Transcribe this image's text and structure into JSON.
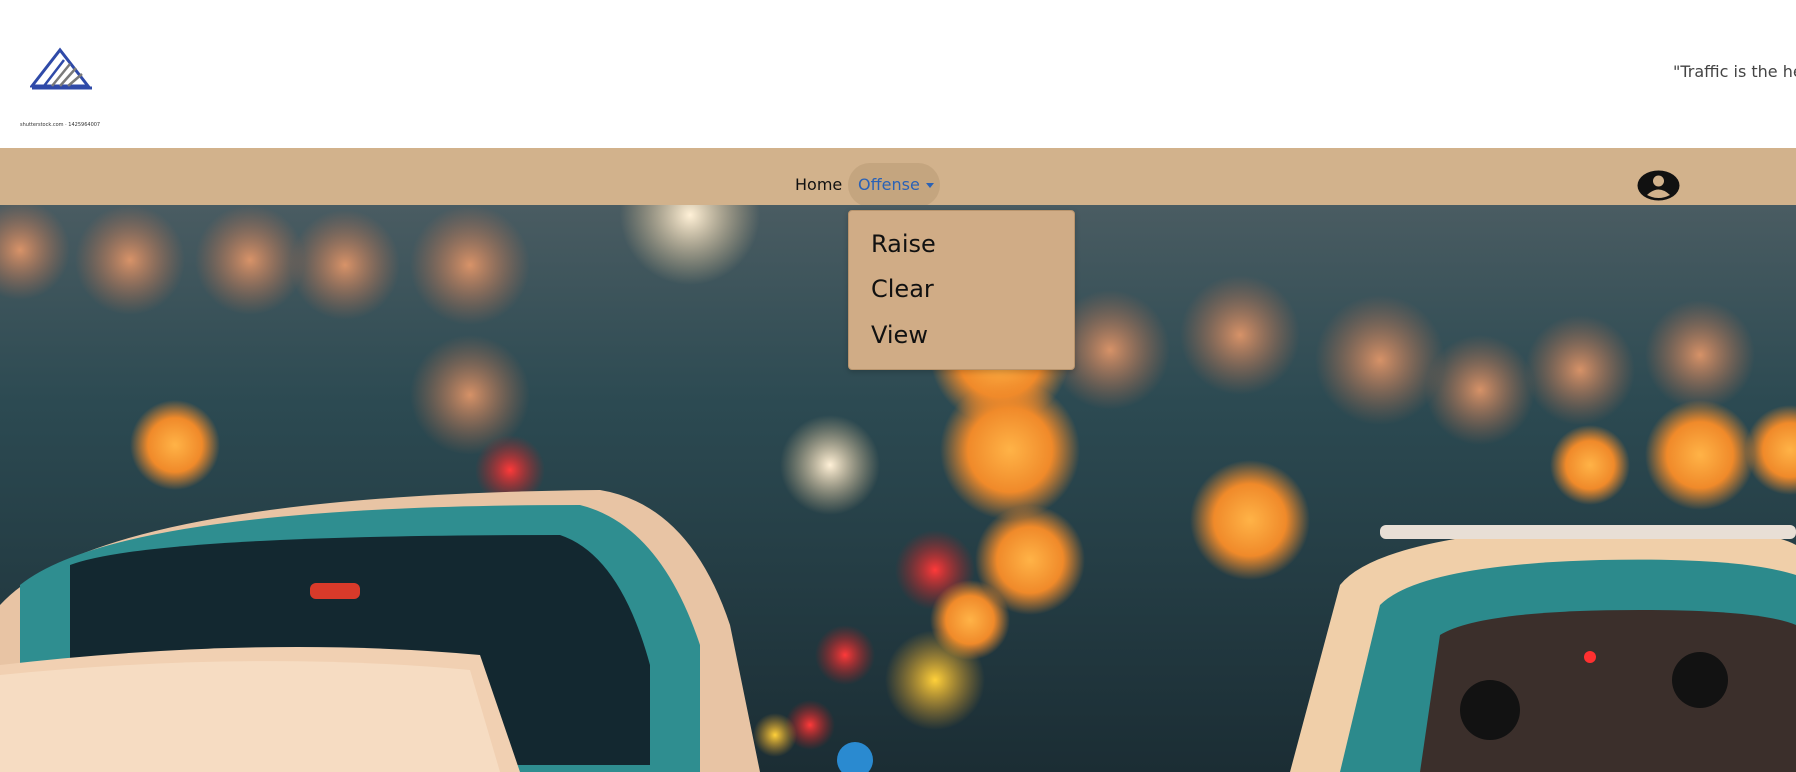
{
  "header": {
    "logo_icon": "mountain-logo-icon",
    "logo_caption": "shutterstock.com · 1425964007",
    "tagline": "\"Traffic is the hea"
  },
  "nav": {
    "home_label": "Home",
    "offense_label": "Offense",
    "profile_icon": "user-circle-icon"
  },
  "dropdown": {
    "items": [
      "Raise",
      "Clear",
      "View"
    ]
  },
  "colors": {
    "navbar_bg": "#d2b28c",
    "dropdown_bg": "#d0ac86",
    "active_link": "#2a62b6",
    "logo_blue": "#2f4aa8"
  }
}
